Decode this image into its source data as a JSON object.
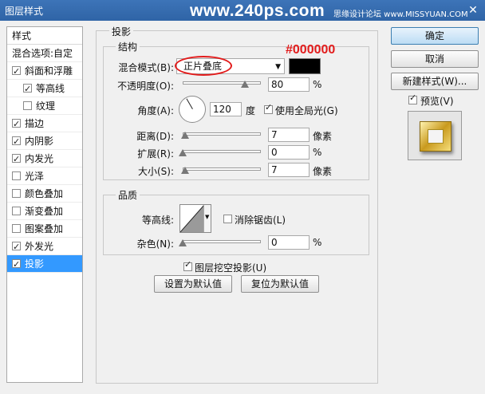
{
  "titlebar": {
    "title": "图层样式",
    "watermark": "www.240ps.com",
    "site": "思缘设计论坛 www.MISSYUAN.COM",
    "close": "✕"
  },
  "sidebar": {
    "header": "样式",
    "items": [
      {
        "label": "混合选项:自定",
        "checkbox": false,
        "checked": false
      },
      {
        "label": "斜面和浮雕",
        "checkbox": true,
        "checked": true
      },
      {
        "label": "等高线",
        "checkbox": true,
        "checked": true
      },
      {
        "label": "纹理",
        "checkbox": true,
        "checked": false
      },
      {
        "label": "描边",
        "checkbox": true,
        "checked": true
      },
      {
        "label": "内阴影",
        "checkbox": true,
        "checked": true
      },
      {
        "label": "内发光",
        "checkbox": true,
        "checked": true
      },
      {
        "label": "光泽",
        "checkbox": true,
        "checked": false
      },
      {
        "label": "颜色叠加",
        "checkbox": true,
        "checked": false
      },
      {
        "label": "渐变叠加",
        "checkbox": true,
        "checked": false
      },
      {
        "label": "图案叠加",
        "checkbox": true,
        "checked": false
      },
      {
        "label": "外发光",
        "checkbox": true,
        "checked": true
      },
      {
        "label": "投影",
        "checkbox": true,
        "checked": true,
        "selected": true
      }
    ]
  },
  "main": {
    "section_title": "投影",
    "structure": {
      "title": "结构",
      "blend_mode_label": "混合模式(B):",
      "blend_mode_value": "正片叠底",
      "color_annotation": "#000000",
      "opacity_label": "不透明度(O):",
      "opacity_value": "80",
      "opacity_unit": "%",
      "opacity_fraction": 0.8,
      "angle_label": "角度(A):",
      "angle_value": "120",
      "angle_unit": "度",
      "global_light_label": "使用全局光(G)",
      "global_light_checked": true,
      "distance_label": "距离(D):",
      "distance_value": "7",
      "distance_unit": "像素",
      "distance_fraction": 0.03,
      "spread_label": "扩展(R):",
      "spread_value": "0",
      "spread_unit": "%",
      "spread_fraction": 0.0,
      "size_label": "大小(S):",
      "size_value": "7",
      "size_unit": "像素",
      "size_fraction": 0.03
    },
    "quality": {
      "title": "品质",
      "contour_label": "等高线:",
      "antialias_label": "消除锯齿(L)",
      "antialias_checked": false,
      "noise_label": "杂色(N):",
      "noise_value": "0",
      "noise_unit": "%",
      "noise_fraction": 0.0
    },
    "knockout_label": "图层挖空投影(U)",
    "knockout_checked": true,
    "make_default_label": "设置为默认值",
    "reset_default_label": "复位为默认值"
  },
  "right": {
    "ok_label": "确定",
    "cancel_label": "取消",
    "new_style_label": "新建样式(W)...",
    "preview_label": "预览(V)",
    "preview_checked": true
  },
  "colors": {
    "shadow_color": "#000000",
    "annotation_red": "#e21b1b",
    "selected_row": "#3399ff"
  }
}
